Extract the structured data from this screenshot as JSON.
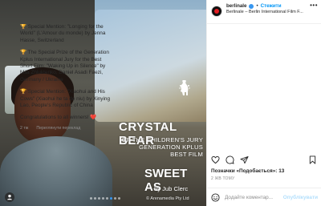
{
  "post": {
    "overlay": {
      "award_title": "CRYSTAL BEAR",
      "line1": "OF THE CHILDREN'S JURY",
      "line2": "GENERATION KPLUS",
      "line3": "BEST FILM",
      "film_title": "SWEET AS",
      "director": "by Jub Clerc",
      "copyright": "© Arenamedia Pty Ltd"
    },
    "carousel": {
      "count": 8,
      "active_index": 5
    }
  },
  "header": {
    "username": "berlinale",
    "follow_label": "Стежити",
    "location": "Berlinale – Berlin International Film F..."
  },
  "caption": {
    "paragraphs": [
      "Special Mention: \"Longing for the World\" (L'Amour du monde) by Jenna Hasse, Switzerland",
      "The Special Prize of the Generation Kplus International Jury for the Best Short Film: \"Waking Up in Silence\" by Mila Zhluktenko, Daniel Asadi Faezi, Germany / Ukraine",
      "Special Mention: \"Xiaohui and His Cows\" (Xiaohui he ta de niu) by Xinying Lao, People's Republic of China",
      "Congratulations to all winners! ❤️"
    ],
    "trophy_emoji": "🏆",
    "time_ago": "2 тж",
    "translate_label": "Переглянути переклад"
  },
  "likes": {
    "text": "Позначки «Подобається»: 13"
  },
  "posted_ago": "2 ЖВ ТОМУ",
  "comment": {
    "placeholder": "Додайте коментар...",
    "publish_label": "Опублікувати"
  },
  "colors": {
    "accent": "#0095f6",
    "verified": "#3897f0",
    "publish_disabled": "#b2dffc",
    "heart": "#ed4956"
  }
}
